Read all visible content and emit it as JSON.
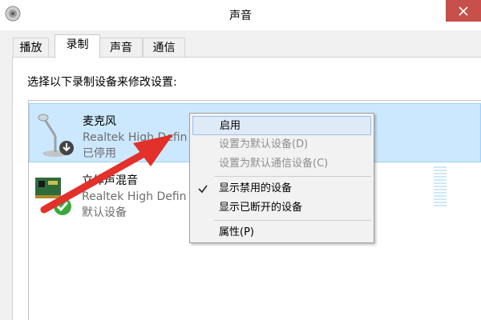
{
  "window": {
    "title": "声音",
    "close_glyph": "×"
  },
  "tabs": [
    {
      "label": "播放",
      "active": false
    },
    {
      "label": "录制",
      "active": true
    },
    {
      "label": "声音",
      "active": false
    },
    {
      "label": "通信",
      "active": false
    }
  ],
  "instruction": "选择以下录制设备来修改设置:",
  "devices": [
    {
      "name": "麦克风",
      "description": "Realtek High Defin",
      "status": "已停用",
      "icon": "microphone-icon",
      "badge": "download-arrow-badge",
      "selected": true
    },
    {
      "name": "立体声混音",
      "description": "Realtek High Defin",
      "status": "默认设备",
      "icon": "sound-card-icon",
      "badge": "green-check-badge",
      "selected": false
    }
  ],
  "context_menu": {
    "items": [
      {
        "label": "启用",
        "enabled": true,
        "highlighted": true,
        "checked": false
      },
      {
        "label": "设置为默认设备(D)",
        "enabled": false,
        "highlighted": false,
        "checked": false
      },
      {
        "label": "设置为默认通信设备(C)",
        "enabled": false,
        "highlighted": false,
        "checked": false
      },
      {
        "label": "显示禁用的设备",
        "enabled": true,
        "highlighted": false,
        "checked": true
      },
      {
        "label": "显示已断开的设备",
        "enabled": true,
        "highlighted": false,
        "checked": false
      },
      {
        "label": "属性(P)",
        "enabled": true,
        "highlighted": false,
        "checked": false
      }
    ]
  },
  "colors": {
    "selection": "#cce8ff",
    "close_button": "#c7504a",
    "annotation_arrow": "#e2302a"
  }
}
